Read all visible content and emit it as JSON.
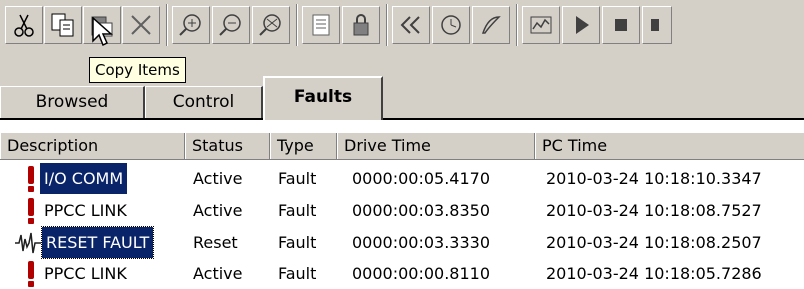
{
  "toolbar": {
    "buttons": [
      {
        "name": "cut-icon"
      },
      {
        "name": "copy-icon"
      },
      {
        "name": "paste-icon"
      },
      {
        "name": "delete-icon"
      },
      {
        "name": "zoom-in-icon"
      },
      {
        "name": "zoom-out-icon"
      },
      {
        "name": "zoom-reset-icon"
      },
      {
        "name": "import-icon"
      },
      {
        "name": "lock-icon"
      },
      {
        "name": "rewind-icon"
      },
      {
        "name": "clock-icon"
      },
      {
        "name": "edit-icon"
      },
      {
        "name": "chart-icon"
      },
      {
        "name": "play-icon"
      },
      {
        "name": "stop-icon"
      }
    ]
  },
  "tooltip": {
    "text": "Copy Items"
  },
  "tabs": [
    {
      "label": "Browsed",
      "active": false
    },
    {
      "label": "Control",
      "active": false
    },
    {
      "label": "Faults",
      "active": true
    }
  ],
  "table": {
    "columns": [
      "Description",
      "Status",
      "Type",
      "Drive Time",
      "PC Time"
    ],
    "rows": [
      {
        "icon": "fault-exclamation-icon",
        "description": "I/O COMM",
        "status": "Active",
        "type": "Fault",
        "drive_time": "0000:00:05.4170",
        "pc_time": "2010-03-24 10:18:10.3347",
        "selected": true
      },
      {
        "icon": "fault-exclamation-icon",
        "description": "PPCC LINK",
        "status": "Active",
        "type": "Fault",
        "drive_time": "0000:00:03.8350",
        "pc_time": "2010-03-24 10:18:08.7527",
        "selected": false
      },
      {
        "icon": "reset-signal-icon",
        "description": "RESET FAULT",
        "status": "Reset",
        "type": "Fault",
        "drive_time": "0000:00:03.3330",
        "pc_time": "2010-03-24 10:18:08.2507",
        "selected": true
      },
      {
        "icon": "fault-exclamation-icon",
        "description": "PPCC LINK",
        "status": "Active",
        "type": "Fault",
        "drive_time": "0000:00:00.8110",
        "pc_time": "2010-03-24 10:18:05.7286",
        "selected": false
      }
    ]
  },
  "colors": {
    "fault_red": "#b00000",
    "selection": "#0a246a",
    "chrome": "#d4d0c8"
  }
}
